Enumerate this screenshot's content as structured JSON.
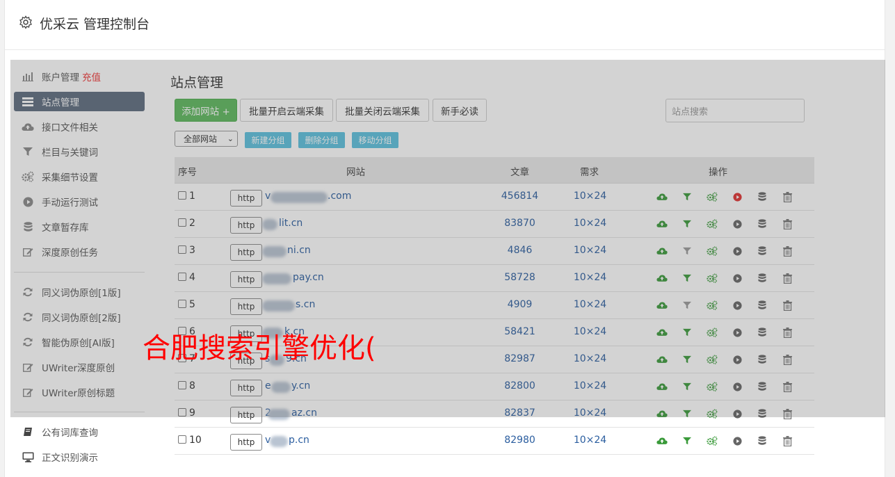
{
  "header": {
    "title": "优采云 管理控制台"
  },
  "sidebar": {
    "items": [
      {
        "label": "账户管理",
        "extra": "充值",
        "icon": "bar-chart-icon"
      },
      {
        "label": "站点管理",
        "icon": "list-icon",
        "active": true
      },
      {
        "label": "接口文件相关",
        "icon": "cloud-upload-icon"
      },
      {
        "label": "栏目与关键词",
        "icon": "filter-icon"
      },
      {
        "label": "采集细节设置",
        "icon": "gears-icon"
      },
      {
        "label": "手动运行测试",
        "icon": "play-icon"
      },
      {
        "label": "文章暂存库",
        "icon": "database-icon"
      },
      {
        "label": "深度原创任务",
        "icon": "edit-icon"
      },
      {
        "label": "同义词伪原创[1版]",
        "icon": "refresh-icon"
      },
      {
        "label": "同义词伪原创[2版]",
        "icon": "refresh-icon"
      },
      {
        "label": "智能伪原创[AI版]",
        "icon": "refresh-icon"
      },
      {
        "label": "UWriter深度原创",
        "icon": "edit-icon"
      },
      {
        "label": "UWriter原创标题",
        "icon": "edit-icon"
      },
      {
        "label": "公有词库查询",
        "icon": "book-icon"
      },
      {
        "label": "正文识别演示",
        "icon": "monitor-icon"
      }
    ]
  },
  "main": {
    "title": "站点管理",
    "toolbar": {
      "add_site": "添加网站 +",
      "batch_open": "批量开启云端采集",
      "batch_close": "批量关闭云端采集",
      "newbie": "新手必读",
      "search_placeholder": "站点搜索"
    },
    "groups": {
      "select_value": "全部网站",
      "new_group": "新建分组",
      "delete_group": "删除分组",
      "move_group": "移动分组"
    },
    "table": {
      "headers": {
        "index": "序号",
        "site": "网站",
        "articles": "文章",
        "demand": "需求",
        "actions": "操作"
      },
      "rows": [
        {
          "num": "1",
          "protocol": "http",
          "site_prefix": "v",
          "site_suffix": ".com",
          "articles": "456814",
          "demand": "10×24"
        },
        {
          "num": "2",
          "protocol": "http",
          "site_prefix": "",
          "site_suffix": "lit.cn",
          "articles": "83870",
          "demand": "10×24"
        },
        {
          "num": "3",
          "protocol": "http",
          "site_prefix": "",
          "site_suffix": "ni.cn",
          "articles": "4846",
          "demand": "10×24"
        },
        {
          "num": "4",
          "protocol": "http",
          "site_prefix": "",
          "site_suffix": "pay.cn",
          "articles": "58728",
          "demand": "10×24"
        },
        {
          "num": "5",
          "protocol": "http",
          "site_prefix": "",
          "site_suffix": "s.cn",
          "articles": "4909",
          "demand": "10×24"
        },
        {
          "num": "6",
          "protocol": "http",
          "site_prefix": "",
          "site_suffix": "k.cn",
          "articles": "58421",
          "demand": "10×24"
        },
        {
          "num": "7",
          "protocol": "http",
          "site_prefix": "s",
          "site_suffix": "9.cn",
          "articles": "82987",
          "demand": "10×24"
        },
        {
          "num": "8",
          "protocol": "http",
          "site_prefix": "e",
          "site_suffix": "y.cn",
          "articles": "82800",
          "demand": "10×24"
        },
        {
          "num": "9",
          "protocol": "http",
          "site_prefix": "2",
          "site_suffix": "az.cn",
          "articles": "82837",
          "demand": "10×24"
        },
        {
          "num": "10",
          "protocol": "http",
          "site_prefix": "v",
          "site_suffix": "p.cn",
          "articles": "82980",
          "demand": "10×24"
        }
      ]
    }
  },
  "watermark": "合肥搜索引擎优化(",
  "colors": {
    "active_nav": "#5c6b7e",
    "green": "#5cb85c",
    "info": "#5bc0de",
    "link": "#2a5d9f",
    "accent_red": "#e33333"
  }
}
